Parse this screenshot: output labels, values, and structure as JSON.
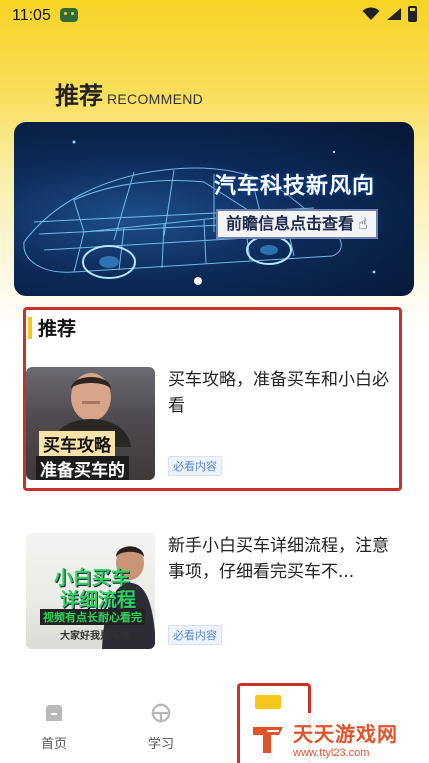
{
  "status_bar": {
    "time": "11:05"
  },
  "header": {
    "title_cn": "推荐",
    "title_en": "RECOMMEND"
  },
  "banner": {
    "title": "汽车科技新风向",
    "subtitle": "前瞻信息点击查看"
  },
  "recommend_list": {
    "title": "推荐",
    "articles": [
      {
        "title": "买车攻略，准备买车和小白必看",
        "tag": "必看内容",
        "thumb_caption_1": "买车攻略",
        "thumb_caption_2": "准备买车的"
      },
      {
        "title": "新手小白买车详细流程，注意事项，仔细看完买车不...",
        "tag": "必看内容",
        "thumb_caption_1": "小白买车",
        "thumb_caption_2": "详细流程",
        "thumb_caption_3": "视频有点长耐心看完",
        "thumb_caption_4": "大家好我是阿修"
      }
    ]
  },
  "bottom_nav": {
    "items": [
      {
        "label": "首页"
      },
      {
        "label": "学习"
      }
    ]
  },
  "watermark": {
    "name": "天天游戏网",
    "url": "www.ttyl23.com"
  },
  "colors": {
    "accent": "#f5c71a",
    "highlight_border": "#c8312a",
    "tag_text": "#5b8bd4"
  }
}
